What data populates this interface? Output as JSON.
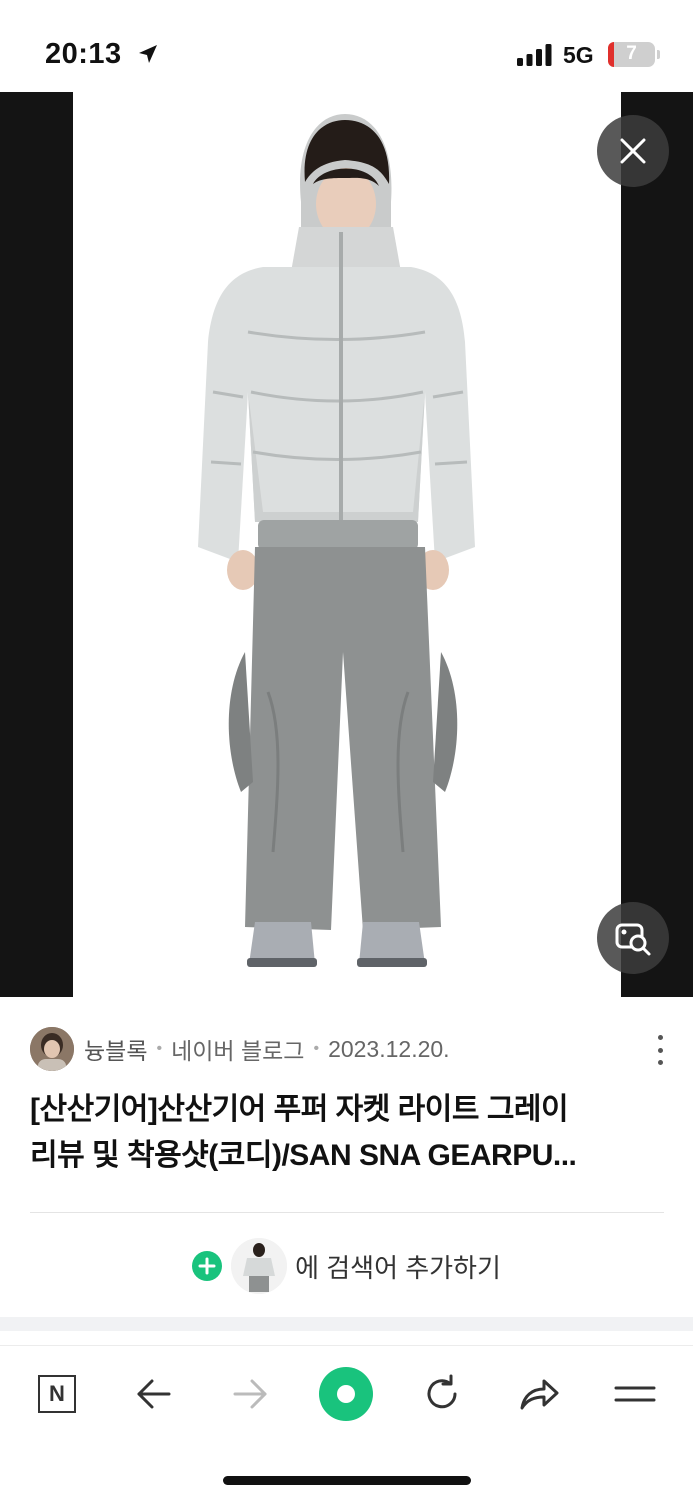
{
  "status_bar": {
    "time": "20:13",
    "network": "5G",
    "battery": "7",
    "battery_level_percent": 7,
    "location_icon": "location-arrow-icon",
    "signal_icon": "cellular-signal-icon"
  },
  "viewer": {
    "close_icon": "close-icon",
    "lens_icon": "image-search-icon",
    "image_subject": "model in light grey puffer jacket and grey cargo pants"
  },
  "result": {
    "author": "늉블록",
    "site": "네이버 블로그",
    "date": "2023.12.20.",
    "separator": "•",
    "title_line1": "[산산기어]산산기어 푸퍼 자켓 라이트 그레이",
    "title_line2": "리뷰 및 착용샷(코디)/SAN SNA GEARPU...",
    "more_icon": "more-vertical-icon"
  },
  "add_keyword": {
    "label": "에 검색어 추가하기",
    "icon": "plus-circle-icon"
  },
  "toolbar": {
    "home_label": "N",
    "items": [
      "naver-home-icon",
      "back-arrow-icon",
      "forward-arrow-icon",
      "green-dot-icon",
      "refresh-icon",
      "share-icon",
      "menu-icon"
    ]
  },
  "colors": {
    "accent_green": "#19c37d",
    "viewer_bg": "#141414",
    "battery_low": "#e0302c"
  }
}
